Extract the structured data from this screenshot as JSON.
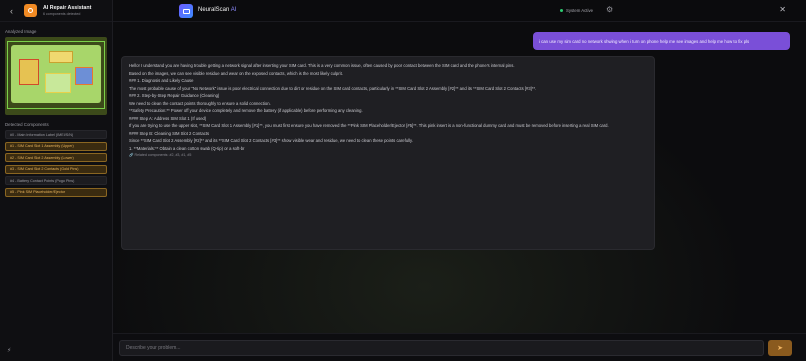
{
  "sidebar": {
    "back_icon": "chevron-left-icon",
    "app_title": "AI Repair Assistant",
    "app_subtitle": "6 components detected",
    "analyzed_label": "Analyzed Image",
    "components_label": "Detected Components",
    "components": [
      {
        "label": "#0 - Main Information Label (IMEI/S/N)",
        "highlight": false
      },
      {
        "label": "#1 - SIM Card Slot 1 Assembly (Upper)",
        "highlight": true
      },
      {
        "label": "#2 - SIM Card Slot 2 Assembly (Lower)",
        "highlight": true
      },
      {
        "label": "#3 - SIM Card Slot 2 Contacts (Gold Pins)",
        "highlight": true
      },
      {
        "label": "#4 - Battery Contact Points (Pogo Pins)",
        "highlight": false
      },
      {
        "label": "#5 - Pink SIM Placeholder/Ejector",
        "highlight": true
      }
    ],
    "bottom_icon": "lightning-icon",
    "bottom_glyph": "⚡"
  },
  "header": {
    "brand_name": "NeuralScan",
    "brand_suffix": "AI",
    "status": "System Active",
    "gear_glyph": "⚙",
    "close_glyph": "✕"
  },
  "chat": {
    "user_message": "i can use my sim card no network shwing when i turn on phone help me see images and help me how to fix pls",
    "bot_paragraphs": [
      "Hello! I understand you are having trouble getting a network signal after inserting your SIM card. This is a very common issue, often caused by poor contact between the SIM card and the phone's internal pins.",
      "Based on the images, we can see visible residue and wear on the exposed contacts, which is the most likely culprit.",
      "### 1. Diagnosis and Likely Cause",
      "The most probable cause of your \"No Network\" issue is poor electrical connection due to dirt or residue on the SIM card contacts, particularly in **SIM Card Slot 2 Assembly [#2]** and its **SIM Card Slot 2 Contacts [#3]**.",
      "### 2. Step-by-Step Repair Guidance (Cleaning)",
      "We need to clean the contact points thoroughly to ensure a solid connection.",
      "**Safety Precaution:** Power off your device completely and remove the battery (if applicable) before performing any cleaning.",
      "#### Step A: Address SIM Slot 1 (If used)",
      "If you are trying to use the upper slot, **SIM Card Slot 1 Assembly [#1]**, you must first ensure you have removed the **Pink SIM Placeholder/Ejector [#5]**. This pink insert is a non-functional dummy card and must be removed before inserting a real SIM card.",
      "#### Step B: Cleaning SIM Slot 2 Contacts",
      "Since **SIM Card Slot 2 Assembly [#2]** and its **SIM Card Slot 2 Contacts [#3]** show visible wear and residue, we need to clean these points carefully.",
      "1.  **Materials:** Obtain a clean cotton swab (Q-tip) or a soft-br"
    ],
    "related": "Related components: #2, #3, #1, #5"
  },
  "composer": {
    "placeholder": "Describe your problem...",
    "send_icon": "send-icon",
    "send_glyph": "➤"
  },
  "colors": {
    "accent_orange": "#f08a24",
    "user_bubble": "#7a4fd8",
    "highlight_text": "#e9b45c",
    "status_dot": "#2ecc71"
  }
}
